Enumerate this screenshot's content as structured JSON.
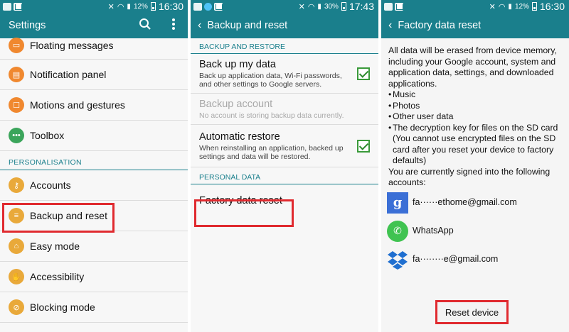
{
  "colors": {
    "teal": "#1a7f8c",
    "highlight": "#e02a2f",
    "check": "#2e8b2e"
  },
  "panel1": {
    "status": {
      "battery": "12%",
      "time": "16:30"
    },
    "title": "Settings",
    "items_top": [
      {
        "label": "Floating messages",
        "icon": "floating-messages-icon"
      },
      {
        "label": "Notification panel",
        "icon": "notification-panel-icon"
      },
      {
        "label": "Motions and gestures",
        "icon": "motions-icon"
      },
      {
        "label": "Toolbox",
        "icon": "toolbox-icon"
      }
    ],
    "section": "PERSONALISATION",
    "items_bottom": [
      {
        "label": "Accounts",
        "icon": "key-icon"
      },
      {
        "label": "Backup and reset",
        "icon": "backup-icon"
      },
      {
        "label": "Easy mode",
        "icon": "home-icon"
      },
      {
        "label": "Accessibility",
        "icon": "hand-icon"
      },
      {
        "label": "Blocking mode",
        "icon": "blocking-icon"
      }
    ]
  },
  "panel2": {
    "status": {
      "battery": "30%",
      "time": "17:43"
    },
    "title": "Backup and reset",
    "section1": "BACKUP AND RESTORE",
    "backup_my_data": {
      "title": "Back up my data",
      "summary": "Back up application data, Wi-Fi passwords, and other settings to Google servers."
    },
    "backup_account": {
      "title": "Backup account",
      "summary": "No account is storing backup data currently."
    },
    "auto_restore": {
      "title": "Automatic restore",
      "summary": "When reinstalling an application, backed up settings and data will be restored."
    },
    "section2": "PERSONAL DATA",
    "factory_reset": "Factory data reset"
  },
  "panel3": {
    "status": {
      "battery": "12%",
      "time": "16:30"
    },
    "title": "Factory data reset",
    "intro": "All data will be erased from device memory, including your Google account, system and application data, settings, and downloaded applications.",
    "bullets": [
      "Music",
      "Photos",
      "Other user data",
      "The decryption key for files on the SD card"
    ],
    "note": "(You cannot use encrypted files on the SD card after you reset your device to factory defaults)",
    "signed_in": "You are currently signed into the following accounts:",
    "accounts": [
      {
        "name": "fa······ethome@gmail.com"
      },
      {
        "name": "WhatsApp"
      },
      {
        "name": "fa········e@gmail.com"
      }
    ],
    "button": "Reset device"
  }
}
